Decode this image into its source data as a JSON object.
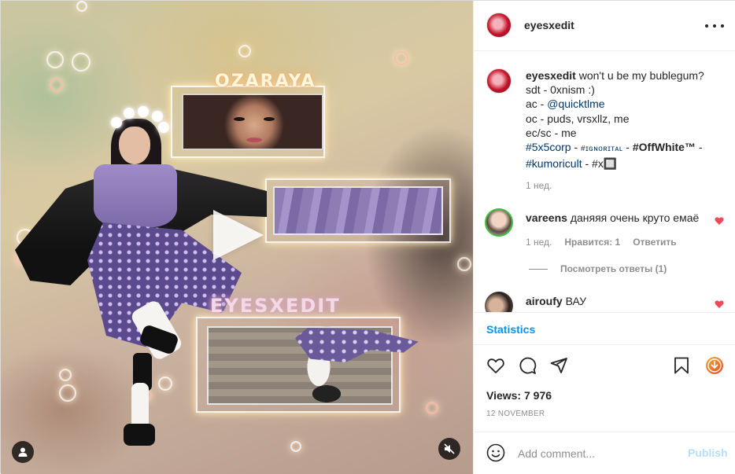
{
  "media": {
    "overlay_title_top": "OZARAYA",
    "overlay_title_bottom": "EYESXEDIT"
  },
  "header": {
    "username": "eyesxedit"
  },
  "caption": {
    "username": "eyesxedit",
    "line1": "won't u be my bublegum?",
    "line2": "sdt - 0xnism :)",
    "line3_prefix": "ac - ",
    "line3_mention": "@quicktlme",
    "line4": "oc - puds, vrsxllz, me",
    "line5": "ec/sc - me",
    "tags": {
      "t1": "#5x5corp",
      "sep": " - ",
      "t2": "#ɪɢɴᴏʀɪᴛᴀʟ",
      "t3": "#OffWhite™",
      "dash": " -",
      "t4": "#kumoricult",
      "t5": "#x🔲"
    },
    "time": "1 нед."
  },
  "comments": [
    {
      "username": "vareens",
      "text": "даняяя очень круто емаё",
      "time": "1 нед.",
      "likes": "Нравится: 1",
      "reply": "Ответить",
      "view_replies": "Посмотреть ответы (1)"
    },
    {
      "username": "airoufy",
      "text": "ВАУ"
    }
  ],
  "statistics_label": "Statistics",
  "views": "Views: 7 976",
  "date": "12 NOVEMBER",
  "add_comment": {
    "placeholder": "Add comment...",
    "publish": "Publish"
  },
  "colors": {
    "link": "#00376b",
    "accent": "#0095f6",
    "heart": "#ed4956",
    "publish_disabled": "#b2dffc"
  }
}
